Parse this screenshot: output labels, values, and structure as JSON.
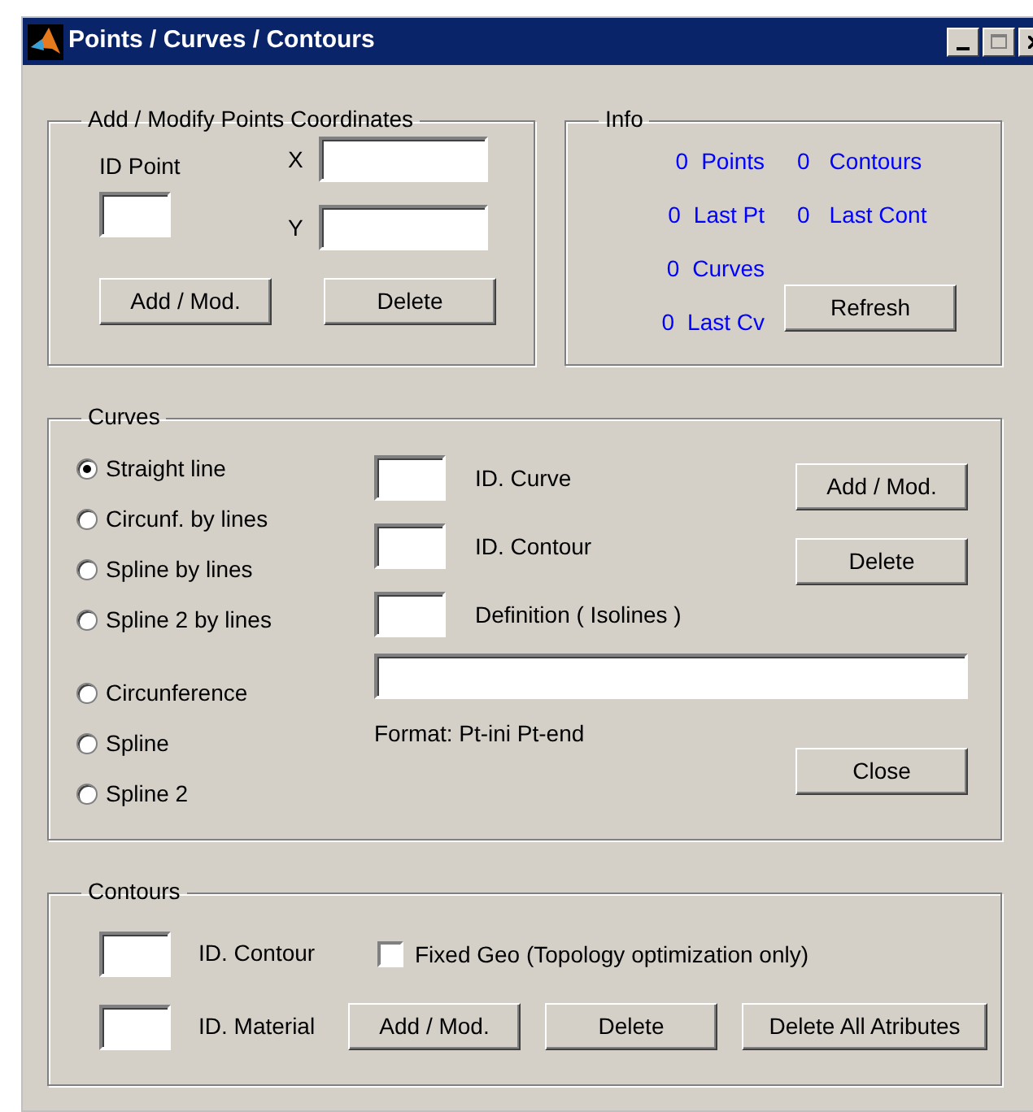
{
  "window": {
    "title": "Points / Curves / Contours"
  },
  "points_group": {
    "title": "Add / Modify Points Coordinates",
    "id_label": "ID Point",
    "x_label": "X",
    "y_label": "Y",
    "buttons": [
      "Add / Mod.",
      "Delete"
    ]
  },
  "info": {
    "title": "Info",
    "stats": [
      {
        "count": "0",
        "label": "Points"
      },
      {
        "count": "0",
        "label": "Last Pt"
      },
      {
        "count": "0",
        "label": "Curves"
      },
      {
        "count": "0",
        "label": "Last Cv"
      },
      {
        "count": "0",
        "label": "Contours"
      },
      {
        "count": "0",
        "label": "Last Cont"
      }
    ],
    "button": "Refresh"
  },
  "curves": {
    "title": "Curves",
    "curve_types": [
      {
        "label": "Straight line",
        "selected": true
      },
      {
        "label": "Circunf. by lines",
        "selected": false
      },
      {
        "label": "Spline by lines",
        "selected": false
      },
      {
        "label": "Spline 2 by lines",
        "selected": false
      },
      {
        "label": "Circunference",
        "selected": false
      },
      {
        "label": "Spline",
        "selected": false
      },
      {
        "label": "Spline 2",
        "selected": false
      }
    ],
    "fields": [
      "ID. Curve",
      "ID. Contour",
      "Definition  ( Isolines )"
    ],
    "format_text": "Format:  Pt-ini  Pt-end",
    "buttons": [
      "Add / Mod.",
      "Delete",
      "Close"
    ]
  },
  "contours": {
    "title": "Contours",
    "fields": [
      "ID. Contour",
      "ID. Material"
    ],
    "fixed_geo": {
      "label": "Fixed Geo (Topology optimization only)",
      "checked": false
    },
    "buttons": [
      "Add / Mod.",
      "Delete",
      "Delete All Atributes"
    ]
  }
}
